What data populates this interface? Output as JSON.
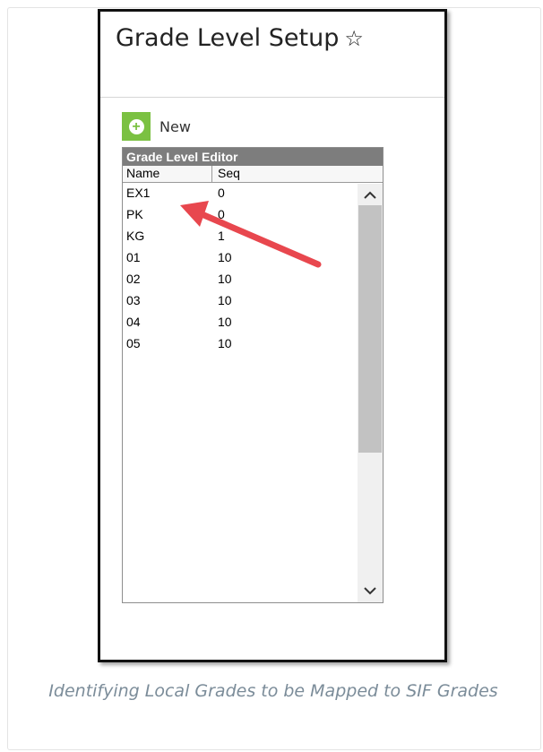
{
  "screenshot": {
    "title": "Grade Level Setup",
    "title_icon": "star-outline-icon",
    "new_button": {
      "icon": "plus-circle-icon",
      "label": "New"
    },
    "editor": {
      "title": "Grade Level Editor",
      "columns": {
        "name": "Name",
        "seq": "Seq"
      },
      "rows": [
        {
          "name": "EX1",
          "seq": "0"
        },
        {
          "name": "PK",
          "seq": "0"
        },
        {
          "name": "KG",
          "seq": "1"
        },
        {
          "name": "01",
          "seq": "10"
        },
        {
          "name": "02",
          "seq": "10"
        },
        {
          "name": "03",
          "seq": "10"
        },
        {
          "name": "04",
          "seq": "10"
        },
        {
          "name": "05",
          "seq": "10"
        }
      ]
    },
    "annotation": {
      "type": "arrow",
      "color": "#e8474e",
      "points_to": "EX1"
    }
  },
  "colors": {
    "new_button_green": "#7bc142",
    "editor_header_gray": "#7d7d7d",
    "caption_gray": "#7b8c99"
  },
  "caption": "Identifying Local Grades to be Mapped to SIF Grades"
}
